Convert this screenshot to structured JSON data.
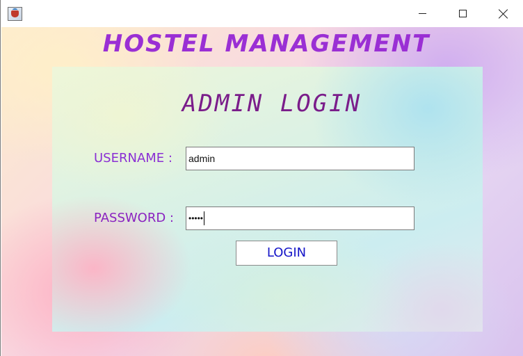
{
  "window": {
    "controls": {
      "minimize_icon": "minimize-icon",
      "maximize_icon": "maximize-icon",
      "close_icon": "close-icon"
    }
  },
  "app": {
    "title": "HOSTEL MANAGEMENT"
  },
  "login_panel": {
    "title": "ADMIN LOGIN",
    "username_label": "USERNAME :",
    "username_value": "admin",
    "password_label": "PASSWORD :",
    "password_masked": "•••••",
    "login_button": "LOGIN"
  },
  "colors": {
    "title": "#9a2fd4",
    "panel_title": "#7a1d8a",
    "label": "#8a2fd4",
    "button_text": "#1414c8"
  }
}
